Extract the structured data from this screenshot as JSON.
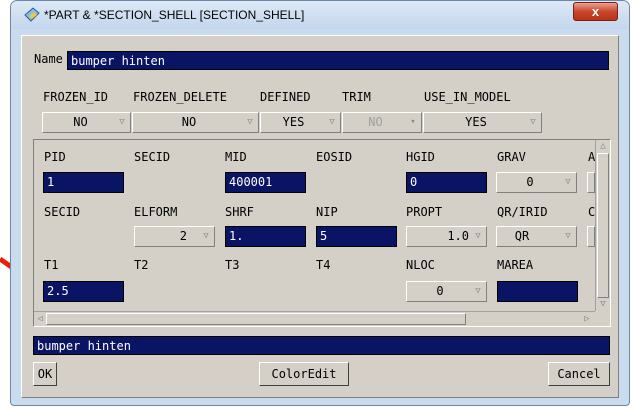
{
  "window": {
    "title": "*PART & *SECTION_SHELL [SECTION_SHELL]",
    "close_label": "x"
  },
  "name": {
    "label": "Name",
    "value": "bumper hinten"
  },
  "header_labels": {
    "frozen_id": "FROZEN_ID",
    "frozen_delete": "FROZEN_DELETE",
    "defined": "DEFINED",
    "trim": "TRIM",
    "use_in_model": "USE_IN_MODEL"
  },
  "header_values": {
    "frozen_id": "NO",
    "frozen_delete": "NO",
    "defined": "YES",
    "trim": "NO",
    "use_in_model": "YES"
  },
  "row1": {
    "labels": {
      "pid": "PID",
      "secid": "SECID",
      "mid": "MID",
      "eosid": "EOSID",
      "hgid": "HGID",
      "grav": "GRAV",
      "adpopt": "A"
    },
    "values": {
      "pid": "1",
      "mid": "400001",
      "hgid": "0",
      "grav": "0"
    }
  },
  "row2": {
    "labels": {
      "secid": "SECID",
      "elform": "ELFORM",
      "shrf": "SHRF",
      "nip": "NIP",
      "propt": "PROPT",
      "qr_irid": "QR/IRID",
      "icomp": "C"
    },
    "values": {
      "elform": "2",
      "shrf": "1.",
      "nip": "5",
      "propt": "1.0",
      "qr_irid": "QR"
    }
  },
  "row3": {
    "labels": {
      "t1": "T1",
      "t2": "T2",
      "t3": "T3",
      "t4": "T4",
      "nloc": "NLOC",
      "marea": "MAREA"
    },
    "values": {
      "t1": "2.5",
      "nloc": "0",
      "marea": ""
    }
  },
  "status": {
    "text": "bumper hinten"
  },
  "buttons": {
    "ok": "OK",
    "coloredit": "ColorEdit",
    "cancel": "Cancel"
  },
  "colors": {
    "field_bg": "#0a1464",
    "arrow": "#e8200a",
    "panel": "#d4d0c8"
  },
  "icons": {
    "app": "lsprepost-app-icon",
    "arrow": "red-pointer-arrow"
  }
}
